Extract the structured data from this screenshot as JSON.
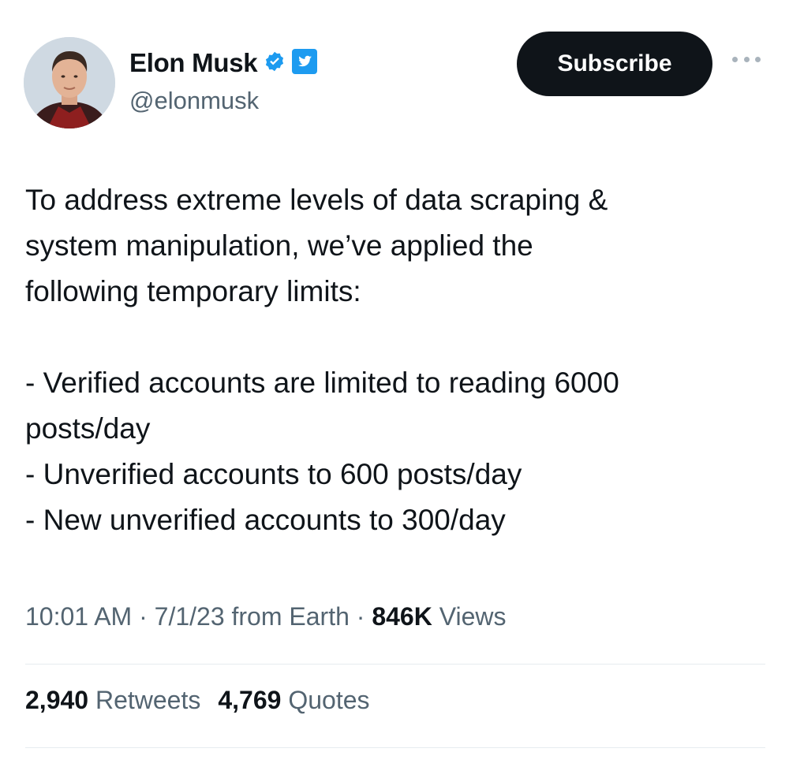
{
  "author": {
    "display_name": "Elon Musk",
    "handle": "@elonmusk",
    "verified_badge_color": "#1d9bf0",
    "avatar_icon": "profile-photo"
  },
  "header": {
    "subscribe_label": "Subscribe",
    "more_icon": "more-horizontal-icon"
  },
  "tweet": {
    "paragraph_1": [
      "To address extreme levels of data scraping &",
      "system manipulation, we’ve applied the",
      "following temporary limits:"
    ],
    "paragraph_2": [
      "- Verified accounts are limited to reading 6000",
      "posts/day",
      "- Unverified accounts to 600 posts/day",
      "- New unverified accounts to 300/day"
    ]
  },
  "meta": {
    "time": "10:01 AM",
    "separator": "·",
    "date_source": "7/1/23 from Earth",
    "views_count": "846K",
    "views_label": "Views"
  },
  "stats": {
    "retweets_count": "2,940",
    "retweets_label": "Retweets",
    "quotes_count": "4,769",
    "quotes_label": "Quotes"
  },
  "colors": {
    "text_primary": "#0f1419",
    "text_secondary": "#536471",
    "button_bg": "#0f1419",
    "divider": "#e6ecf0",
    "accent": "#1d9bf0"
  }
}
